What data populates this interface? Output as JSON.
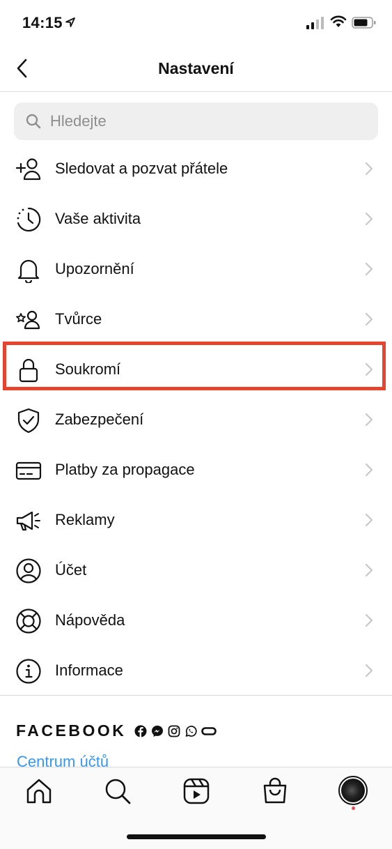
{
  "status_bar": {
    "time": "14:15"
  },
  "header": {
    "title": "Nastavení"
  },
  "search": {
    "placeholder": "Hledejte",
    "value": ""
  },
  "menu": [
    {
      "label": "Sledovat a pozvat přátele",
      "icon": "add-person-icon"
    },
    {
      "label": "Vaše aktivita",
      "icon": "activity-clock-icon"
    },
    {
      "label": "Upozornění",
      "icon": "bell-icon"
    },
    {
      "label": "Tvůrce",
      "icon": "creator-icon"
    },
    {
      "label": "Soukromí",
      "icon": "lock-icon",
      "highlighted": true
    },
    {
      "label": "Zabezpečení",
      "icon": "shield-check-icon"
    },
    {
      "label": "Platby za propagace",
      "icon": "credit-card-icon"
    },
    {
      "label": "Reklamy",
      "icon": "megaphone-icon"
    },
    {
      "label": "Účet",
      "icon": "account-circle-icon"
    },
    {
      "label": "Nápověda",
      "icon": "lifebuoy-icon"
    },
    {
      "label": "Informace",
      "icon": "info-icon"
    }
  ],
  "facebook": {
    "brand": "FACEBOOK",
    "accounts_link": "Centrum účtů"
  },
  "tab_bar": [
    {
      "name": "home-tab",
      "icon": "home-icon"
    },
    {
      "name": "search-tab",
      "icon": "search-icon"
    },
    {
      "name": "reels-tab",
      "icon": "reels-icon"
    },
    {
      "name": "shop-tab",
      "icon": "shopping-bag-icon"
    },
    {
      "name": "profile-tab",
      "icon": "avatar"
    }
  ],
  "colors": {
    "highlight": "#e6442e",
    "link": "#3897f0",
    "notification_dot": "#ed4956"
  }
}
